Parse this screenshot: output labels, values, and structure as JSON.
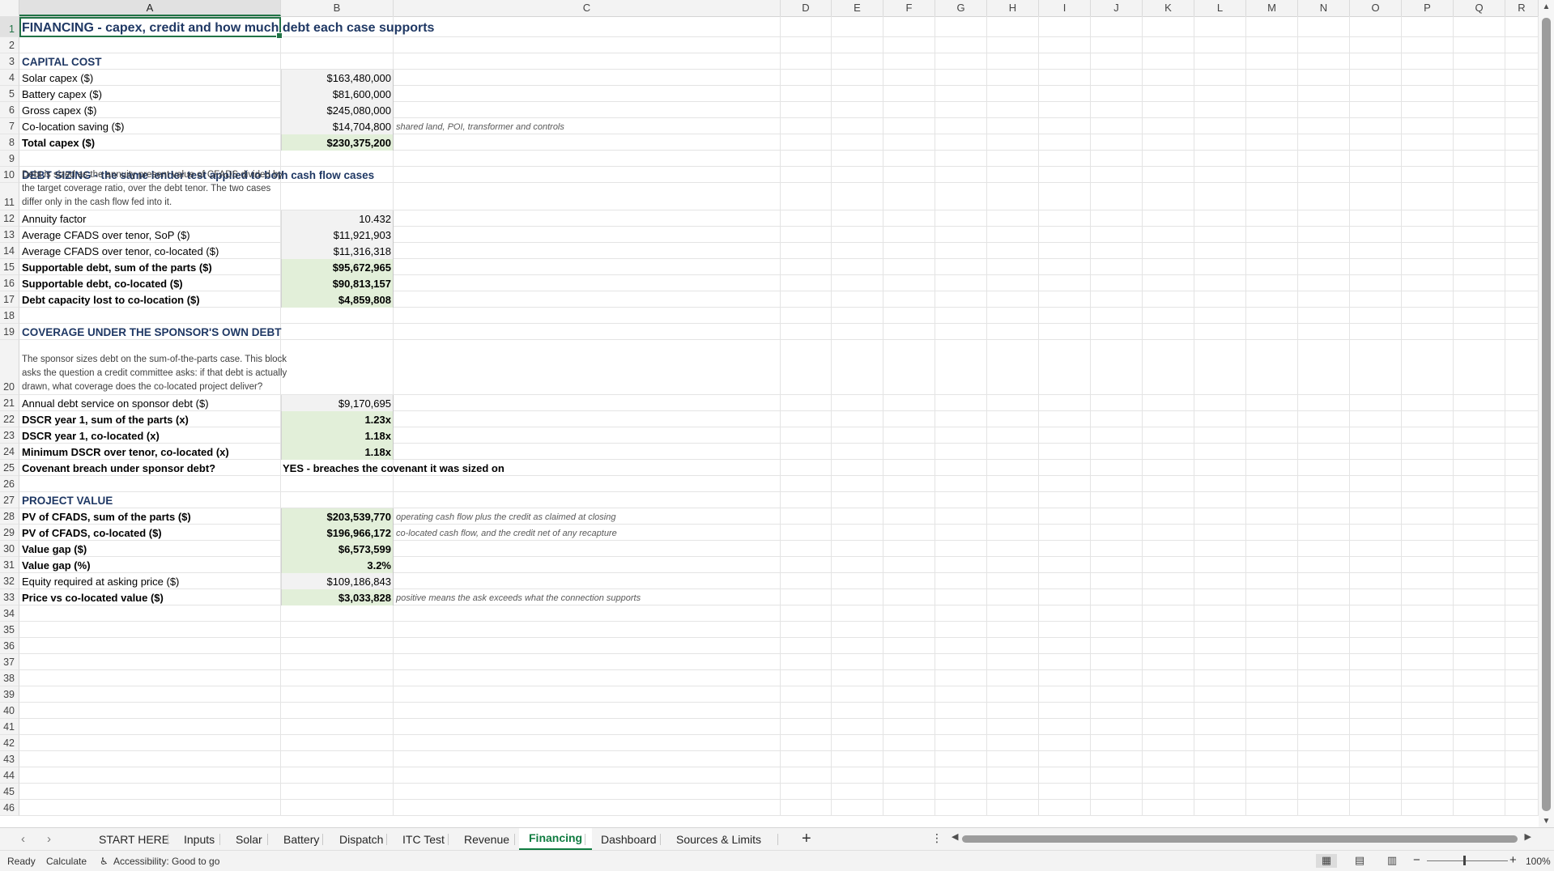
{
  "columns": [
    "A",
    "B",
    "C",
    "D",
    "E",
    "F",
    "G",
    "H",
    "I",
    "J",
    "K",
    "L",
    "M",
    "N",
    "O",
    "P",
    "Q",
    "R"
  ],
  "rows": [
    {
      "n": "1",
      "a": "FINANCING - capex, credit and how much debt each case supports",
      "style": "title"
    },
    {
      "n": "2"
    },
    {
      "n": "3",
      "a": "CAPITAL COST",
      "style": "sect"
    },
    {
      "n": "4",
      "a": "Solar capex ($)",
      "b": "$163,480,000",
      "bstyle": "grey"
    },
    {
      "n": "5",
      "a": "Battery capex ($)",
      "b": "$81,600,000",
      "bstyle": "grey"
    },
    {
      "n": "6",
      "a": "Gross capex ($)",
      "b": "$245,080,000",
      "bstyle": "grey"
    },
    {
      "n": "7",
      "a": "Co-location saving ($)",
      "b": "$14,704,800",
      "bstyle": "grey",
      "c": "shared land, POI, transformer and controls"
    },
    {
      "n": "8",
      "a": "Total capex ($)",
      "style": "bold",
      "b": "$230,375,200",
      "bstyle": "green"
    },
    {
      "n": "9"
    },
    {
      "n": "10",
      "a": "DEBT SIZING - the same lender test applied to both cash flow cases",
      "style": "sect"
    },
    {
      "n": "11",
      "a": "Debt is sized as the annuity present value of CFADS divided by the target coverage ratio, over the debt tenor. The two cases differ only in the cash flow fed into it.",
      "style": "note"
    },
    {
      "n": "12",
      "a": "Annuity factor",
      "b": "10.432",
      "bstyle": "grey"
    },
    {
      "n": "13",
      "a": "Average CFADS over tenor, SoP ($)",
      "b": "$11,921,903",
      "bstyle": "grey"
    },
    {
      "n": "14",
      "a": "Average CFADS over tenor, co-located ($)",
      "b": "$11,316,318",
      "bstyle": "grey"
    },
    {
      "n": "15",
      "a": "Supportable debt, sum of the parts ($)",
      "style": "bold",
      "b": "$95,672,965",
      "bstyle": "green"
    },
    {
      "n": "16",
      "a": "Supportable debt, co-located ($)",
      "style": "bold",
      "b": "$90,813,157",
      "bstyle": "green"
    },
    {
      "n": "17",
      "a": "Debt capacity lost to co-location ($)",
      "style": "bold",
      "b": "$4,859,808",
      "bstyle": "green"
    },
    {
      "n": "18"
    },
    {
      "n": "19",
      "a": "COVERAGE UNDER THE SPONSOR'S OWN DEBT",
      "style": "sect"
    },
    {
      "n": "20",
      "a": "The sponsor sizes debt on the sum-of-the-parts case. This block asks the question a credit committee asks: if that debt is actually drawn, what coverage does the co-located project deliver?",
      "style": "note"
    },
    {
      "n": "21",
      "a": "Annual debt service on sponsor debt ($)",
      "b": "$9,170,695",
      "bstyle": "grey"
    },
    {
      "n": "22",
      "a": "DSCR year 1, sum of the parts (x)",
      "style": "bold",
      "b": "1.23x",
      "bstyle": "green"
    },
    {
      "n": "23",
      "a": "DSCR year 1, co-located (x)",
      "style": "bold",
      "b": "1.18x",
      "bstyle": "green"
    },
    {
      "n": "24",
      "a": "Minimum DSCR over tenor, co-located (x)",
      "style": "bold",
      "b": "1.18x",
      "bstyle": "green"
    },
    {
      "n": "25",
      "a": "Covenant breach under sponsor debt?",
      "style": "bold",
      "b": "YES - breaches the covenant it was sized on",
      "bstyle": "textv"
    },
    {
      "n": "26"
    },
    {
      "n": "27",
      "a": "PROJECT VALUE",
      "style": "sect"
    },
    {
      "n": "28",
      "a": "PV of CFADS, sum of the parts ($)",
      "style": "bold",
      "b": "$203,539,770",
      "bstyle": "green",
      "c": "operating cash flow plus the credit as claimed at closing"
    },
    {
      "n": "29",
      "a": "PV of CFADS, co-located ($)",
      "style": "bold",
      "b": "$196,966,172",
      "bstyle": "green",
      "c": "co-located cash flow, and the credit net of any recapture"
    },
    {
      "n": "30",
      "a": "Value gap ($)",
      "style": "bold",
      "b": "$6,573,599",
      "bstyle": "green"
    },
    {
      "n": "31",
      "a": "Value gap (%)",
      "style": "bold",
      "b": "3.2%",
      "bstyle": "green"
    },
    {
      "n": "32",
      "a": "Equity required at asking price ($)",
      "b": "$109,186,843",
      "bstyle": "grey"
    },
    {
      "n": "33",
      "a": "Price vs co-located value ($)",
      "style": "bold",
      "b": "$3,033,828",
      "bstyle": "green",
      "c": "positive means the ask exceeds what the connection supports"
    },
    {
      "n": "34"
    },
    {
      "n": "35"
    },
    {
      "n": "36"
    },
    {
      "n": "37"
    },
    {
      "n": "38"
    },
    {
      "n": "39"
    },
    {
      "n": "40"
    },
    {
      "n": "41"
    },
    {
      "n": "42"
    },
    {
      "n": "43"
    },
    {
      "n": "44"
    },
    {
      "n": "45"
    },
    {
      "n": "46"
    }
  ],
  "tabs": [
    "START HERE",
    "Inputs",
    "Solar",
    "Battery",
    "Dispatch",
    "ITC Test",
    "Revenue",
    "Financing",
    "Dashboard",
    "Sources & Limits"
  ],
  "active_tab": "Financing",
  "status": {
    "ready": "Ready",
    "calculate": "Calculate",
    "accessibility": "Accessibility: Good to go",
    "zoom": "100%",
    "zoom_minus": "−",
    "zoom_plus": "+"
  },
  "icons": {
    "add_sheet": "+",
    "more": "⋮",
    "prev": "‹",
    "next": "›",
    "accessibility_icon": "♿"
  },
  "colors": {
    "accent": "#217346",
    "section_text": "#1f3864",
    "input_fill": "#f2f2f2",
    "output_fill": "#e2efd9"
  }
}
